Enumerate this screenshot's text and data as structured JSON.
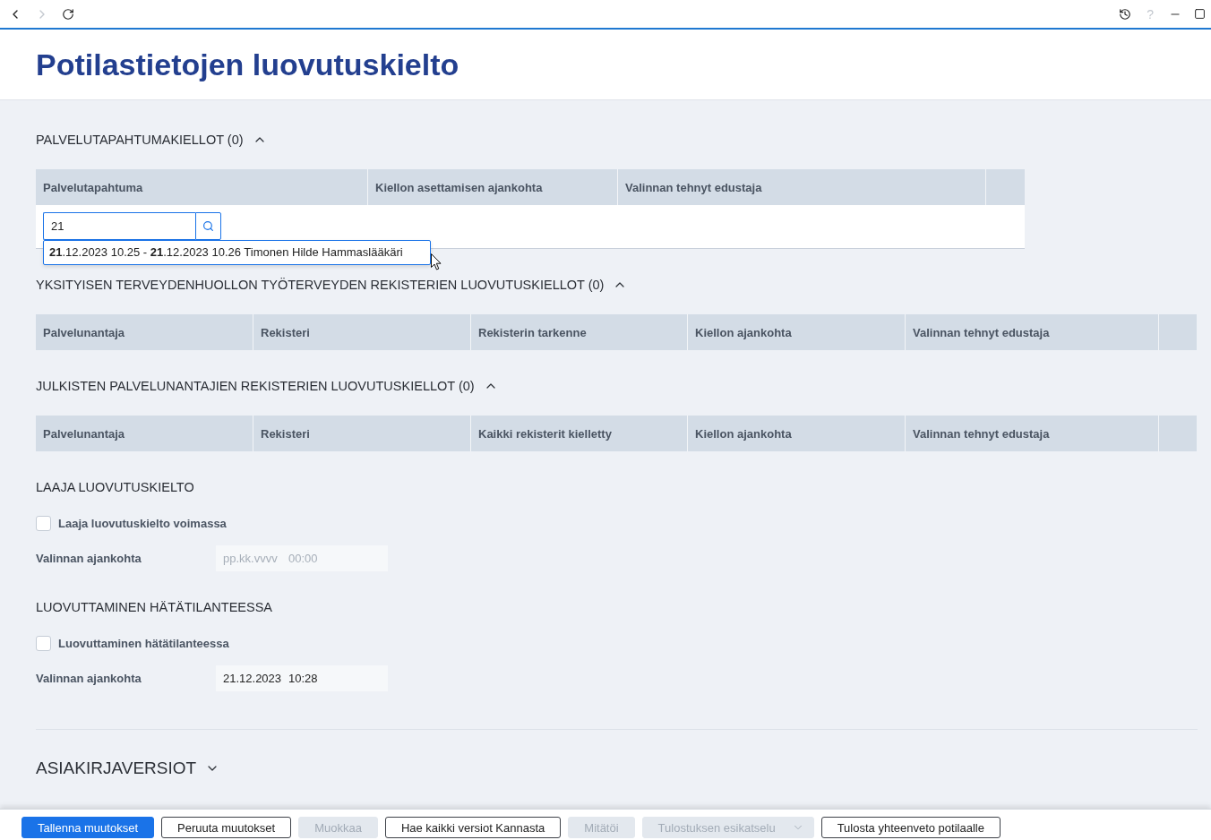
{
  "toolbar": {
    "navigation": [
      {
        "kind": "back",
        "disabled": false
      },
      {
        "kind": "forward",
        "disabled": true
      },
      {
        "kind": "reload",
        "disabled": false
      }
    ],
    "help": {
      "label": "?",
      "disabled": true
    }
  },
  "header": {
    "title": "Potilastietojen luovutuskielto"
  },
  "sections": [
    {
      "kind": "search_table",
      "title": "PALVELUTAPAHTUMAKIELLOT (0)",
      "expanded": true,
      "columns": [
        "Palvelutapahtuma",
        "Kiellon asettamisen ajankohta",
        "Valinnan tehnyt edustaja"
      ],
      "search": {
        "value": "21",
        "suggestions": [
          "**21**.12.2023 10.25 - **21**.12.2023 10.26 Timonen Hilde Hammaslääkäri"
        ]
      }
    },
    {
      "kind": "table",
      "title": "YKSITYISEN TERVEYDENHUOLLON TYÖTERVEYDEN REKISTERIEN LUOVUTUSKIELLOT (0)",
      "expanded": true,
      "columns": [
        "Palvelunantaja",
        "Rekisteri",
        "Rekisterin tarkenne",
        "Kiellon ajankohta",
        "Valinnan tehnyt edustaja"
      ]
    },
    {
      "kind": "table",
      "title": "JULKISTEN PALVELUNANTAJIEN REKISTERIEN LUOVUTUSKIELLOT (0)",
      "expanded": true,
      "columns": [
        "Palvelunantaja",
        "Rekisteri",
        "Kaikki rekisterit kielletty",
        "Kiellon ajankohta",
        "Valinnan tehnyt edustaja"
      ]
    },
    {
      "kind": "consent",
      "title": "LAAJA LUOVUTUSKIELTO",
      "checkbox": {
        "label": "Laaja luovutuskielto voimassa",
        "checked": false
      },
      "date_field": {
        "label": "Valinnan ajankohta",
        "date": {
          "placeholder": "pp.kk.vvvv"
        },
        "time": {
          "placeholder": "00:00"
        }
      }
    },
    {
      "kind": "consent",
      "title": "LUOVUTTAMINEN HÄTÄTILANTEESSA",
      "checkbox": {
        "label": "Luovuttaminen hätätilanteessa",
        "checked": false
      },
      "date_field": {
        "label": "Valinnan ajankohta",
        "date": {
          "value": "21.12.2023"
        },
        "time": {
          "value": "10:28"
        }
      }
    },
    {
      "kind": "collapsible",
      "title": "ASIAKIRJAVERSIOT",
      "expanded": false
    }
  ],
  "footer": {
    "buttons": [
      {
        "label": "Tallenna muutokset",
        "kind": "primary",
        "disabled": false
      },
      {
        "label": "Peruuta muutokset",
        "kind": "outline",
        "disabled": false
      },
      {
        "label": "Muokkaa",
        "kind": "outline",
        "disabled": true
      },
      {
        "label": "Hae kaikki versiot Kannasta",
        "kind": "outline",
        "disabled": false
      },
      {
        "label": "Mitätöi",
        "kind": "outline",
        "disabled": true
      },
      {
        "label": "Tulostuksen esikatselu",
        "kind": "dropdown",
        "disabled": true
      },
      {
        "label": "Tulosta yhteenveto potilaalle",
        "kind": "outline",
        "disabled": false
      }
    ]
  }
}
